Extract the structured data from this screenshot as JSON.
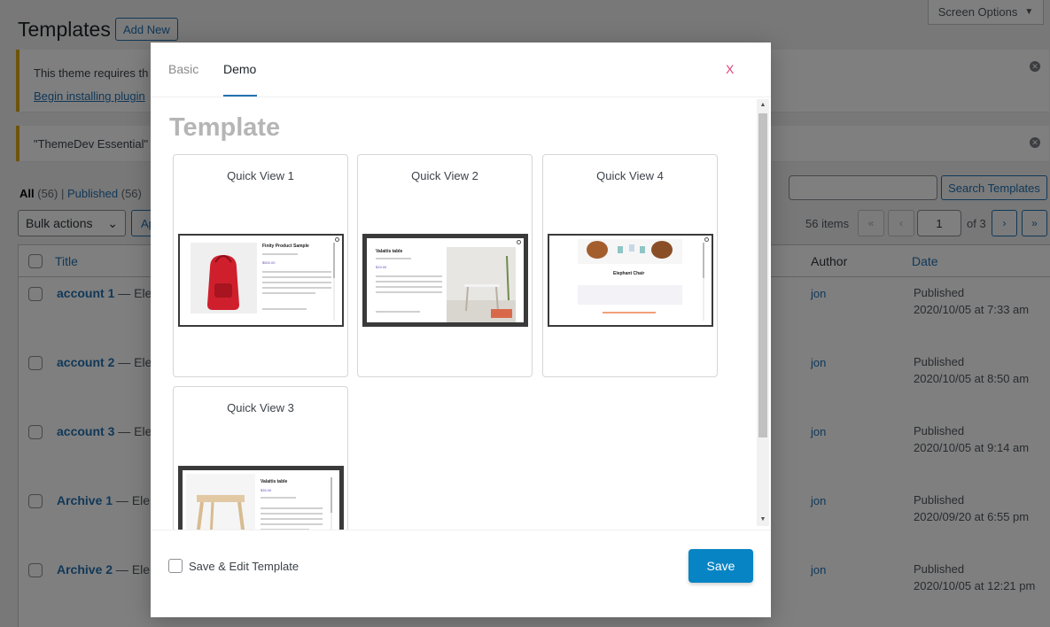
{
  "page": {
    "title": "Templates",
    "add_new": "Add New",
    "screen_options": "Screen Options"
  },
  "notices": {
    "n1_text": "This theme requires th",
    "n1_link": "Begin installing plugin",
    "n2_text": "\"ThemeDev Essential\" r"
  },
  "filters": {
    "all_label": "All",
    "all_count": "(56)",
    "sep": "|",
    "published_label": "Published",
    "published_count": "(56)",
    "bulk_actions": "Bulk actions",
    "apply": "Ap"
  },
  "search": {
    "button": "Search Templates",
    "value": ""
  },
  "pagination": {
    "items": "56 items",
    "first": "«",
    "prev": "‹",
    "current": "1",
    "of": "of 3",
    "next": "›",
    "last": "»"
  },
  "table": {
    "col_title": "Title",
    "col_author": "Author",
    "col_date": "Date",
    "rows": [
      {
        "title": "account 1",
        "suffix": " — Elem",
        "author": "jon",
        "status": "Published",
        "date": "2020/10/05 at 7:33 am"
      },
      {
        "title": "account 2",
        "suffix": " — Elem",
        "author": "jon",
        "status": "Published",
        "date": "2020/10/05 at 8:50 am"
      },
      {
        "title": "account 3",
        "suffix": " — Elem",
        "author": "jon",
        "status": "Published",
        "date": "2020/10/05 at 9:14 am"
      },
      {
        "title": "Archive 1",
        "suffix": " — Elem",
        "author": "jon",
        "status": "Published",
        "date": "2020/09/20 at 6:55 pm"
      },
      {
        "title": "Archive 2",
        "suffix": " — Elem",
        "author": "jon",
        "status": "Published",
        "date": "2020/10/05 at 12:21 pm"
      }
    ]
  },
  "modal": {
    "tab_basic": "Basic",
    "tab_demo": "Demo",
    "close": "X",
    "section_title": "Template",
    "cards": [
      {
        "title": "Quick View 1",
        "thumb_title": "Finity Product Sample",
        "thumb_price": "$500.00"
      },
      {
        "title": "Quick View 2",
        "thumb_title": "Valaitis table",
        "thumb_price": "$15.00"
      },
      {
        "title": "Quick View 4",
        "thumb_title": "Elephant Chair",
        "thumb_price": ""
      },
      {
        "title": "Quick View 3",
        "thumb_title": "Valaitis table",
        "thumb_price": "$35.00"
      }
    ],
    "save_edit_label": "Save & Edit Template",
    "save_button": "Save"
  },
  "colors": {
    "accent": "#2271b1",
    "save_button": "#0784c3",
    "close_x": "#e0457b",
    "notice_border": "#dba617"
  }
}
